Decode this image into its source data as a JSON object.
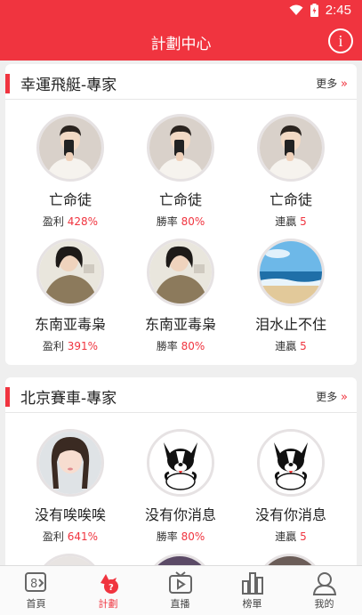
{
  "status": {
    "time": "2:45"
  },
  "header": {
    "title": "計劃中心"
  },
  "sections": [
    {
      "title": "幸運飛艇-專家",
      "more": "更多",
      "experts": [
        {
          "name": "亡命徒",
          "stat_label": "盈利",
          "stat_value": "428%",
          "avatar": "boy"
        },
        {
          "name": "亡命徒",
          "stat_label": "勝率",
          "stat_value": "80%",
          "avatar": "boy"
        },
        {
          "name": "亡命徒",
          "stat_label": "連贏",
          "stat_value": "5",
          "avatar": "boy"
        },
        {
          "name": "东南亚毒枭",
          "stat_label": "盈利",
          "stat_value": "391%",
          "avatar": "girl-sweater"
        },
        {
          "name": "东南亚毒枭",
          "stat_label": "勝率",
          "stat_value": "80%",
          "avatar": "girl-sweater"
        },
        {
          "name": "泪水止不住",
          "stat_label": "連贏",
          "stat_value": "5",
          "avatar": "beach"
        }
      ]
    },
    {
      "title": "北京賽車-專家",
      "more": "更多",
      "experts": [
        {
          "name": "没有唉唉唉",
          "stat_label": "盈利",
          "stat_value": "641%",
          "avatar": "girl-braids"
        },
        {
          "name": "没有你消息",
          "stat_label": "勝率",
          "stat_value": "80%",
          "avatar": "dog"
        },
        {
          "name": "没有你消息",
          "stat_label": "連贏",
          "stat_value": "5",
          "avatar": "dog"
        }
      ]
    }
  ],
  "tabs": [
    {
      "label": "首頁",
      "icon": "lottery-icon",
      "active": false
    },
    {
      "label": "計劃",
      "icon": "plan-icon",
      "active": true
    },
    {
      "label": "直播",
      "icon": "tv-play-icon",
      "active": false
    },
    {
      "label": "榜單",
      "icon": "bar-chart-icon",
      "active": false
    },
    {
      "label": "我的",
      "icon": "user-icon",
      "active": false
    }
  ],
  "colors": {
    "brand": "#f0343f",
    "background": "#efefef"
  }
}
